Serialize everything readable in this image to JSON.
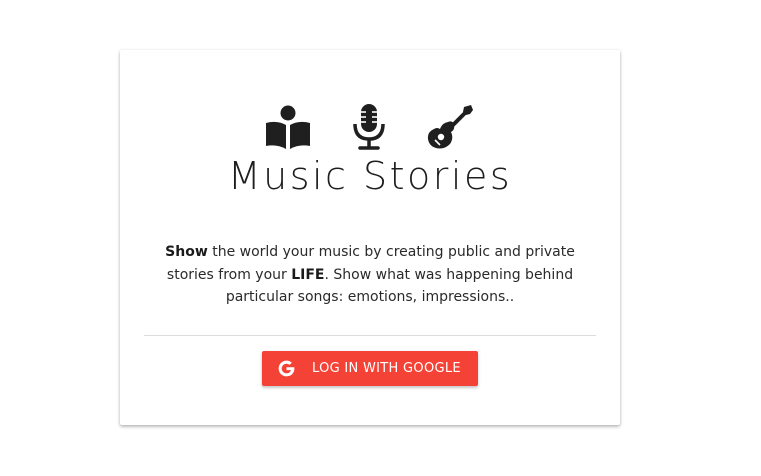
{
  "card": {
    "icons": [
      "book-reader-icon",
      "microphone-icon",
      "guitar-icon"
    ],
    "title": "Music Stories",
    "description": {
      "lead_bold": "Show",
      "part1": " the world your music by creating public and private stories from your ",
      "life_bold": "LIFE",
      "part2": ". Show what was happening behind particular songs: emotions, impressions.."
    },
    "login_button": {
      "label": "LOG IN WITH GOOGLE",
      "icon": "google-icon",
      "color": "#f44336"
    }
  },
  "colors": {
    "background": "#ffffff",
    "card": "#ffffff",
    "title_text": "#1e1e1e",
    "body_text": "#2a2a2a",
    "button": "#f44336"
  }
}
